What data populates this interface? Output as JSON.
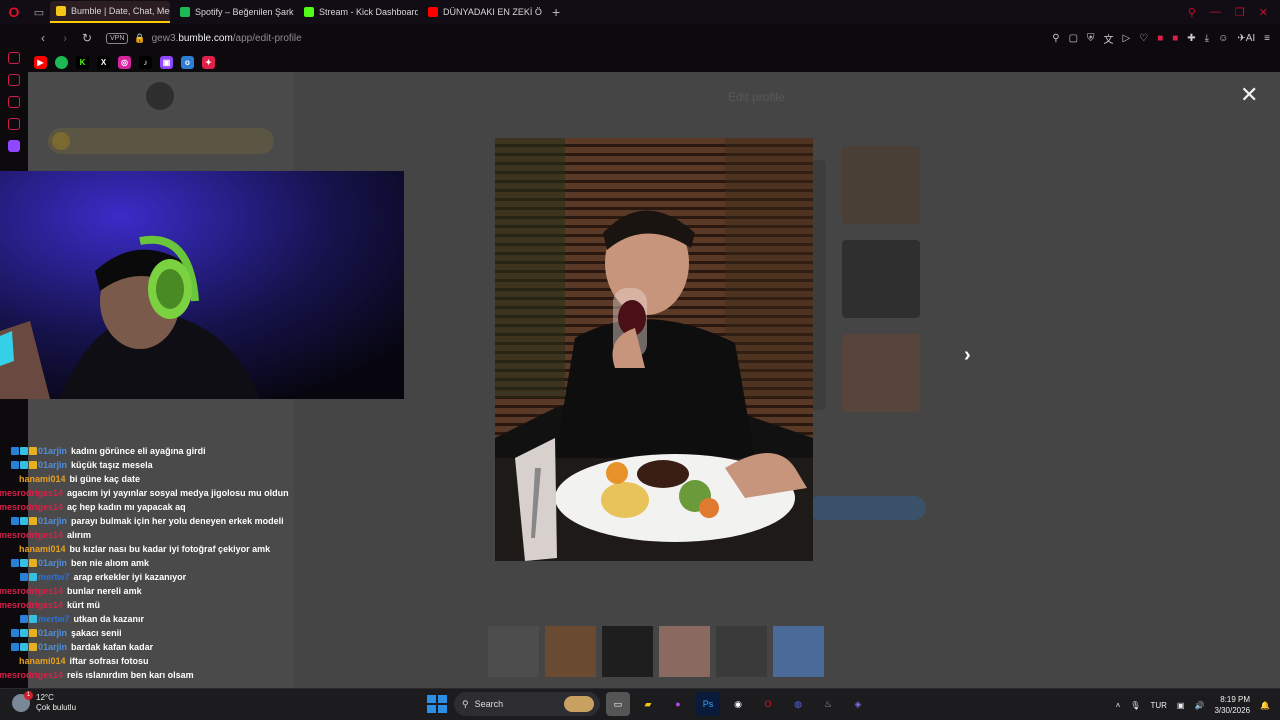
{
  "browser": {
    "tabs": [
      {
        "title": "Bumble | Date, Chat, Meet",
        "color": "#f5c518",
        "active": true
      },
      {
        "title": "Spotify – Beğenilen Şarkılar",
        "color": "#1db954",
        "active": false
      },
      {
        "title": "Stream - Kick Dashboard",
        "color": "#53fc18",
        "active": false
      },
      {
        "title": "DÜNYADAKI EN ZEKİ ÖRÜMCEK",
        "color": "#ff0000",
        "active": false
      }
    ],
    "new_tab": "+",
    "url_prefix": "gew3.",
    "url_domain": "bumble.com",
    "url_path": "/app/edit-profile",
    "vpn_label": "VPN",
    "ai_label": "AI"
  },
  "page": {
    "title": "Edit profile",
    "close_glyph": "✕",
    "next_glyph": "›"
  },
  "chat": [
    {
      "user": "01arjin",
      "color": "#4f8fdc",
      "badges": 3,
      "text": "kadını görünce eli ayağına girdi"
    },
    {
      "user": "01arjin",
      "color": "#4f8fdc",
      "badges": 3,
      "text": "küçük taşız mesela"
    },
    {
      "user": "hanami014",
      "color": "#e8a020",
      "badges": 0,
      "text": "bi güne kaç date"
    },
    {
      "user": "mesrodriges14",
      "color": "#d8204a",
      "badges": 0,
      "text": "agacım iyi yayınlar sosyal medya jigolosu mu oldun"
    },
    {
      "user": "mesrodriges14",
      "color": "#d8204a",
      "badges": 0,
      "text": "aç hep kadın mı yapacak aq"
    },
    {
      "user": "01arjin",
      "color": "#4f8fdc",
      "badges": 3,
      "text": "parayı bulmak için her yolu deneyen erkek modeli"
    },
    {
      "user": "mesrodriges14",
      "color": "#d8204a",
      "badges": 0,
      "text": "alırım"
    },
    {
      "user": "hanami014",
      "color": "#e8a020",
      "badges": 0,
      "text": "bu kızlar nası bu kadar iyi fotoğraf çekiyor amk"
    },
    {
      "user": "01arjin",
      "color": "#4f8fdc",
      "badges": 3,
      "text": "ben nie alıom amk"
    },
    {
      "user": "mertw7",
      "color": "#2e6fd0",
      "badges": 2,
      "text": "arap erkekler iyi kazanıyor"
    },
    {
      "user": "mesrodriges14",
      "color": "#d8204a",
      "badges": 0,
      "text": "bunlar nereli amk"
    },
    {
      "user": "mesrodriges14",
      "color": "#d8204a",
      "badges": 0,
      "text": "kürt mü"
    },
    {
      "user": "mertw7",
      "color": "#2e6fd0",
      "badges": 2,
      "text": "utkan da kazanır"
    },
    {
      "user": "01arjin",
      "color": "#4f8fdc",
      "badges": 3,
      "text": "şakacı senii"
    },
    {
      "user": "01arjin",
      "color": "#4f8fdc",
      "badges": 3,
      "text": "bardak kafan kadar"
    },
    {
      "user": "hanami014",
      "color": "#e8a020",
      "badges": 0,
      "text": "iftar sofrası fotosu"
    },
    {
      "user": "mesrodriges14",
      "color": "#d8204a",
      "badges": 0,
      "text": "reis ıslanırdım ben karı olsam"
    }
  ],
  "taskbar": {
    "weather_temp": "12°C",
    "weather_desc": "Çok bulutlu",
    "search_label": "Search",
    "language": "TUR",
    "time": "8:19 PM",
    "date": "3/30/2026"
  }
}
